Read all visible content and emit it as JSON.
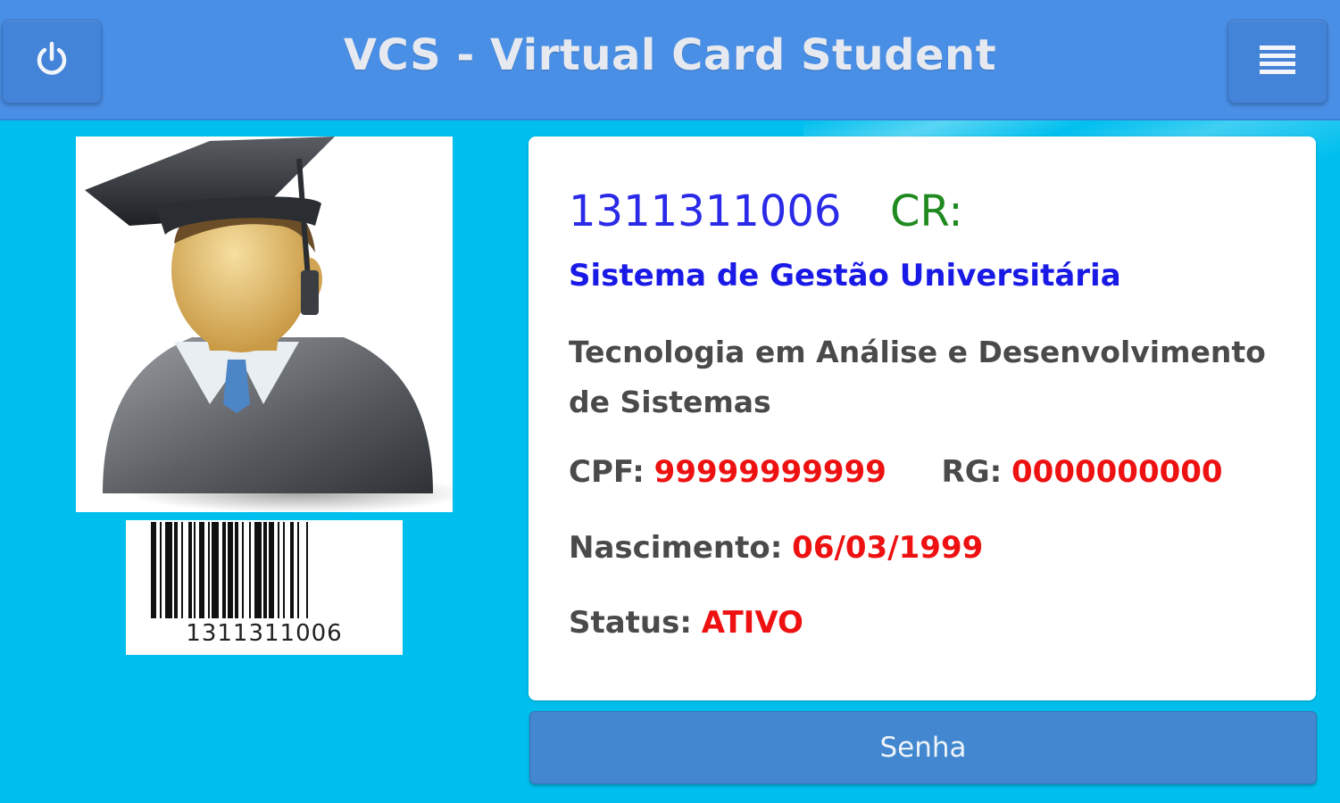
{
  "header": {
    "title": "VCS - Virtual Card Student",
    "power_icon": "power-icon",
    "menu_icon": "menu-icon"
  },
  "student": {
    "photo_icon": "graduate-avatar-icon",
    "barcode_number": "1311311006",
    "matricula": "1311311006",
    "cr_label": "CR:",
    "institution": "Sistema de Gestão Universitária",
    "course": "Tecnologia em Análise e Desenvolvimento de Sistemas",
    "cpf_label": "CPF:",
    "cpf_value": "99999999999",
    "rg_label": "RG:",
    "rg_value": "0000000000",
    "birth_label": "Nascimento:",
    "birth_value": "06/03/1999",
    "status_label": "Status:",
    "status_value": "ATIVO"
  },
  "actions": {
    "senha_label": "Senha"
  },
  "colors": {
    "background": "#00bfee",
    "header": "#4a8fe6",
    "button": "#4287cf",
    "id_blue": "#2a2ae8",
    "cr_green": "#1f8a1f",
    "value_red": "#ee1111"
  }
}
